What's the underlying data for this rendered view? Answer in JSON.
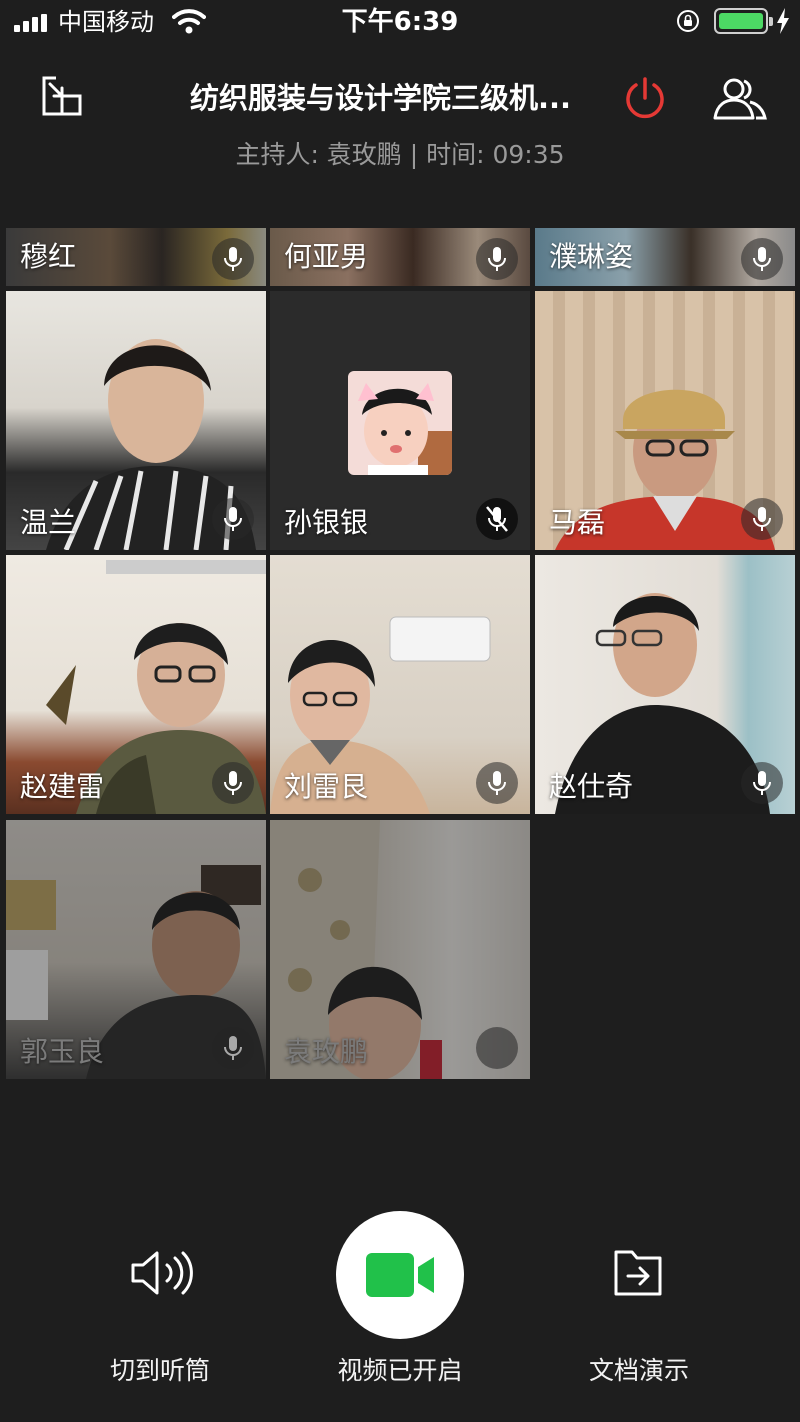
{
  "status_bar": {
    "carrier": "中国移动",
    "time": "下午6:39",
    "battery_level": 1.0,
    "signal_icon": "signal-bars-icon",
    "wifi_icon": "wifi-icon",
    "lock_icon": "rotation-lock-icon",
    "charging_icon": "charging-bolt-icon"
  },
  "header": {
    "title": "纺织服装与设计学院三级机...",
    "subtitle": "主持人: 袁玫鹏 | 时间: 09:35",
    "minimize_icon": "minimize-window-icon",
    "end_icon": "power-icon",
    "members_icon": "members-icon"
  },
  "participants": [
    {
      "name": "穆红",
      "mic": "on"
    },
    {
      "name": "何亚男",
      "mic": "on"
    },
    {
      "name": "濮琳姿",
      "mic": "on"
    },
    {
      "name": "温兰",
      "mic": "on"
    },
    {
      "name": "孙银银",
      "mic": "muted"
    },
    {
      "name": "马磊",
      "mic": "on"
    },
    {
      "name": "赵建雷",
      "mic": "on"
    },
    {
      "name": "刘雷艮",
      "mic": "on"
    },
    {
      "name": "赵仕奇",
      "mic": "on"
    },
    {
      "name": "郭玉良",
      "mic": "on"
    },
    {
      "name": "袁玫鹏",
      "mic": "on"
    }
  ],
  "controls": {
    "speaker_label": "切到听筒",
    "video_label": "视频已开启",
    "doc_label": "文档演示"
  },
  "colors": {
    "background": "#1e1e1e",
    "accent_green": "#21c14a",
    "end_red": "#e53935",
    "battery_green": "#4cd964"
  }
}
